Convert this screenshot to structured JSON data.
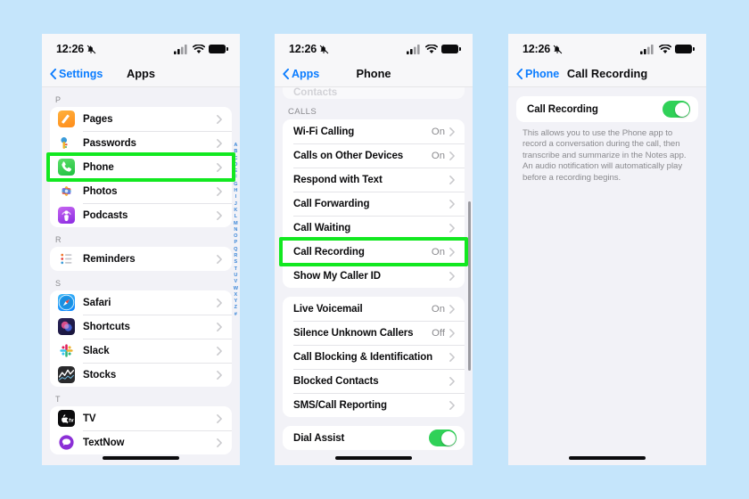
{
  "background_color": "#c5e5fb",
  "highlight_color": "#12e820",
  "accent_blue": "#0a7cff",
  "toggle_green": "#30d158",
  "status_bar": {
    "time": "12:26",
    "mute_icon": "bell-slash-icon",
    "signal_icon": "cellular-signal-icon",
    "wifi_icon": "wifi-icon",
    "battery_icon": "battery-icon"
  },
  "screen1": {
    "nav": {
      "back_label": "Settings",
      "title": "Apps"
    },
    "alpha_index": [
      "A",
      "B",
      "C",
      "D",
      "E",
      "F",
      "G",
      "H",
      "I",
      "J",
      "K",
      "L",
      "M",
      "N",
      "O",
      "P",
      "Q",
      "R",
      "S",
      "T",
      "U",
      "V",
      "W",
      "X",
      "Y",
      "Z",
      "#"
    ],
    "sections": [
      {
        "header": "P",
        "rows": [
          {
            "label": "Pages",
            "icon": "pages-app-icon",
            "icon_class": "ic-pages",
            "highlighted": false
          },
          {
            "label": "Passwords",
            "icon": "passwords-app-icon",
            "icon_class": "ic-pass",
            "highlighted": false
          },
          {
            "label": "Phone",
            "icon": "phone-app-icon",
            "icon_class": "ic-phone",
            "highlighted": true
          },
          {
            "label": "Photos",
            "icon": "photos-app-icon",
            "icon_class": "ic-photos",
            "highlighted": false
          },
          {
            "label": "Podcasts",
            "icon": "podcasts-app-icon",
            "icon_class": "ic-podcasts",
            "highlighted": false
          }
        ]
      },
      {
        "header": "R",
        "rows": [
          {
            "label": "Reminders",
            "icon": "reminders-app-icon",
            "icon_class": "ic-reminders",
            "highlighted": false
          }
        ]
      },
      {
        "header": "S",
        "rows": [
          {
            "label": "Safari",
            "icon": "safari-app-icon",
            "icon_class": "ic-safari",
            "highlighted": false
          },
          {
            "label": "Shortcuts",
            "icon": "shortcuts-app-icon",
            "icon_class": "ic-shortcuts",
            "highlighted": false
          },
          {
            "label": "Slack",
            "icon": "slack-app-icon",
            "icon_class": "ic-slack",
            "highlighted": false
          },
          {
            "label": "Stocks",
            "icon": "stocks-app-icon",
            "icon_class": "ic-stocks",
            "highlighted": false
          }
        ]
      },
      {
        "header": "T",
        "rows": [
          {
            "label": "TV",
            "icon": "tv-app-icon",
            "icon_class": "ic-tv",
            "highlighted": false
          },
          {
            "label": "TextNow",
            "icon": "textnow-app-icon",
            "icon_class": "ic-textnow",
            "highlighted": false
          }
        ]
      }
    ]
  },
  "screen2": {
    "nav": {
      "back_label": "Apps",
      "title": "Phone"
    },
    "partial_row_above": "Contacts",
    "sections": [
      {
        "header": "CALLS",
        "rows": [
          {
            "label": "Wi-Fi Calling",
            "value": "On",
            "highlighted": false
          },
          {
            "label": "Calls on Other Devices",
            "value": "On",
            "highlighted": false
          },
          {
            "label": "Respond with Text",
            "value": "",
            "highlighted": false
          },
          {
            "label": "Call Forwarding",
            "value": "",
            "highlighted": false
          },
          {
            "label": "Call Waiting",
            "value": "",
            "highlighted": false
          },
          {
            "label": "Call Recording",
            "value": "On",
            "highlighted": true
          },
          {
            "label": "Show My Caller ID",
            "value": "",
            "highlighted": false
          }
        ]
      },
      {
        "header": "",
        "rows": [
          {
            "label": "Live Voicemail",
            "value": "On",
            "highlighted": false
          },
          {
            "label": "Silence Unknown Callers",
            "value": "Off",
            "highlighted": false
          },
          {
            "label": "Call Blocking & Identification",
            "value": "",
            "highlighted": false
          },
          {
            "label": "Blocked Contacts",
            "value": "",
            "highlighted": false
          },
          {
            "label": "SMS/Call Reporting",
            "value": "",
            "highlighted": false
          }
        ]
      },
      {
        "header": "",
        "rows": [
          {
            "label": "Dial Assist",
            "value": "",
            "toggle": "on",
            "highlighted": false
          }
        ]
      }
    ]
  },
  "screen3": {
    "nav": {
      "back_label": "Phone",
      "title": "Call Recording"
    },
    "toggle_row": {
      "label": "Call Recording",
      "toggle": "on"
    },
    "description": "This allows you to use the Phone app to record a conversation during the call, then transcribe and summarize in the Notes app. An audio notification will automatically play before a recording begins."
  }
}
